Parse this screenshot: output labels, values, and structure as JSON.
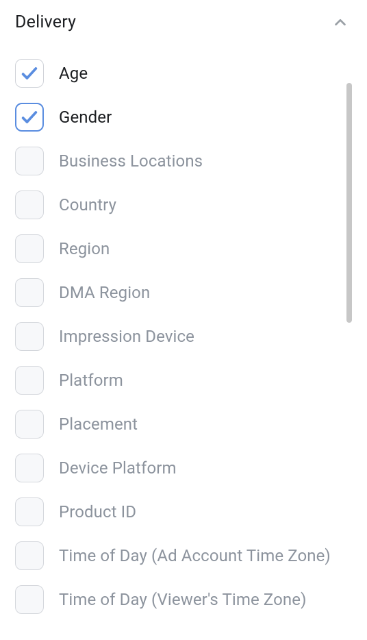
{
  "section": {
    "title": "Delivery",
    "expanded": true
  },
  "options": [
    {
      "label": "Age",
      "checked": true,
      "focused": false
    },
    {
      "label": "Gender",
      "checked": true,
      "focused": true
    },
    {
      "label": "Business Locations",
      "checked": false,
      "focused": false
    },
    {
      "label": "Country",
      "checked": false,
      "focused": false
    },
    {
      "label": "Region",
      "checked": false,
      "focused": false
    },
    {
      "label": "DMA Region",
      "checked": false,
      "focused": false
    },
    {
      "label": "Impression Device",
      "checked": false,
      "focused": false
    },
    {
      "label": "Platform",
      "checked": false,
      "focused": false
    },
    {
      "label": "Placement",
      "checked": false,
      "focused": false
    },
    {
      "label": "Device Platform",
      "checked": false,
      "focused": false
    },
    {
      "label": "Product ID",
      "checked": false,
      "focused": false
    },
    {
      "label": "Time of Day (Ad Account Time Zone)",
      "checked": false,
      "focused": false
    },
    {
      "label": "Time of Day (Viewer's Time Zone)",
      "checked": false,
      "focused": false
    }
  ]
}
